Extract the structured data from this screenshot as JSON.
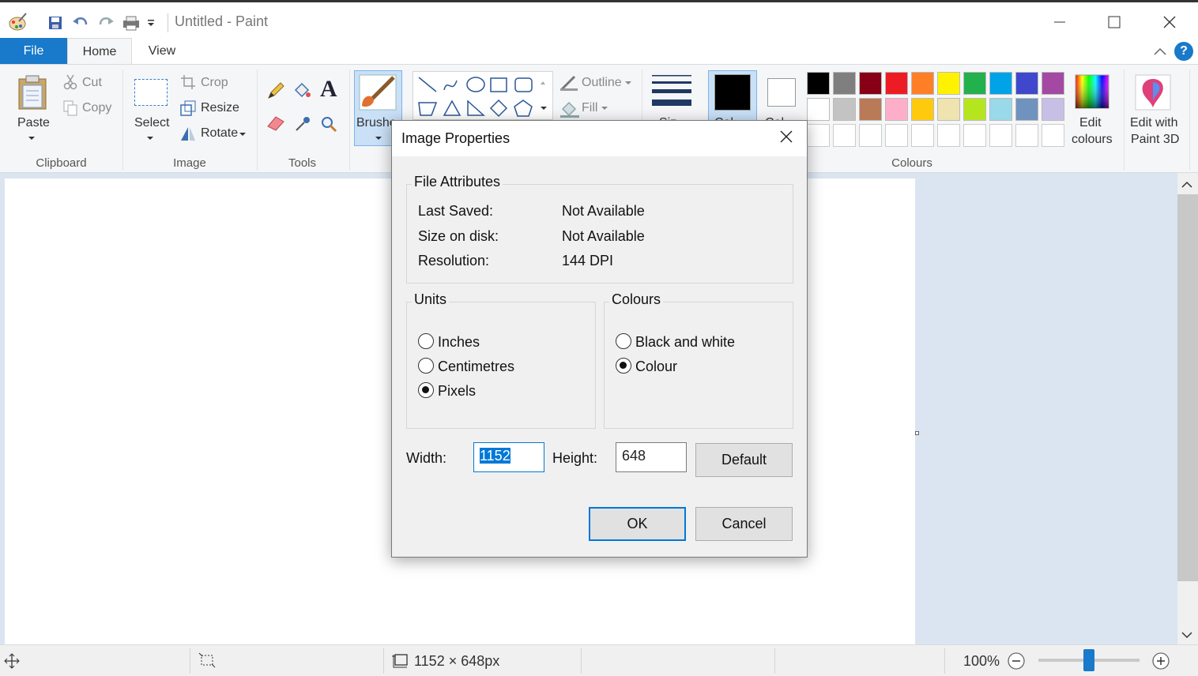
{
  "app": {
    "title": "Untitled - Paint"
  },
  "tabs": [
    "File",
    "Home",
    "View"
  ],
  "clipboard": {
    "paste": "Paste",
    "cut": "Cut",
    "copy": "Copy",
    "label": "Clipboard"
  },
  "image_group": {
    "select": "Select",
    "crop": "Crop",
    "resize": "Resize",
    "rotate": "Rotate",
    "label": "Image"
  },
  "tools_group": {
    "label": "Tools"
  },
  "brushes": {
    "label": "Brushe"
  },
  "shapes": {
    "outline": "Outline",
    "fill": "Fill"
  },
  "size": {
    "label": "Siz"
  },
  "colour1": {
    "label": "Col",
    "color": "#000000"
  },
  "colour2": {
    "label": "Col",
    "color": "#ffffff"
  },
  "colours": {
    "label": "Colours",
    "row1": [
      "#000000",
      "#7f7f7f",
      "#880015",
      "#ed1c24",
      "#ff7f27",
      "#fff200",
      "#22b14c",
      "#00a2e8",
      "#3f48cc",
      "#a349a4"
    ],
    "row2": [
      "#ffffff",
      "#c3c3c3",
      "#b97a57",
      "#ffaec9",
      "#ffc90e",
      "#efe4b0",
      "#b5e61d",
      "#99d9ea",
      "#7092be",
      "#c8bfe7"
    ],
    "edit_colours": [
      "Edit",
      "colours"
    ],
    "edit_paint3d": [
      "Edit with",
      "Paint 3D"
    ]
  },
  "statusbar": {
    "dimensions": "1152 × 648px",
    "zoom": "100%",
    "zoom_level": 0.5
  },
  "dialog": {
    "title": "Image Properties",
    "file_attributes": {
      "legend": "File Attributes",
      "last_saved_label": "Last Saved:",
      "last_saved_value": "Not Available",
      "size_label": "Size on disk:",
      "size_value": "Not Available",
      "resolution_label": "Resolution:",
      "resolution_value": "144 DPI"
    },
    "units": {
      "legend": "Units",
      "options": [
        "Inches",
        "Centimetres",
        "Pixels"
      ],
      "selected": "Pixels"
    },
    "colours": {
      "legend": "Colours",
      "options": [
        "Black and white",
        "Colour"
      ],
      "selected": "Colour"
    },
    "width_label": "Width:",
    "width_value": "1152",
    "height_label": "Height:",
    "height_value": "648",
    "default_button": "Default",
    "ok_button": "OK",
    "cancel_button": "Cancel"
  }
}
